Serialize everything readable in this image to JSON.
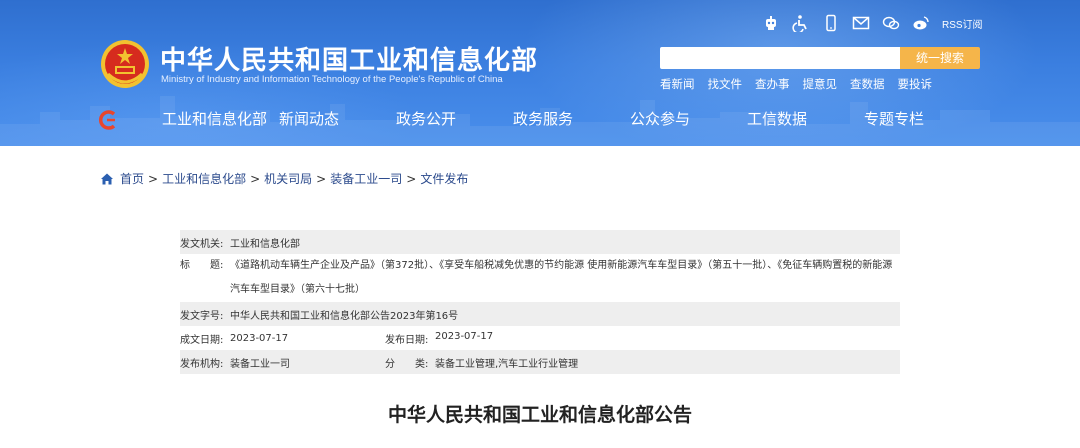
{
  "header": {
    "title": "中华人民共和国工业和信息化部",
    "subtitle": "Ministry of Industry and Information Technology of the People's Republic of China",
    "rss_label": "RSS订阅",
    "top_icons": [
      "robot-icon",
      "accessibility-icon",
      "mobile-icon",
      "mail-icon",
      "wechat-icon",
      "weibo-icon"
    ]
  },
  "search": {
    "placeholder": "",
    "button_label": "统一搜索"
  },
  "quick_links": [
    "看新闻",
    "找文件",
    "查办事",
    "提意见",
    "查数据",
    "要投诉"
  ],
  "nav": [
    "工业和信息化部",
    "新闻动态",
    "政务公开",
    "政务服务",
    "公众参与",
    "工信数据",
    "专题专栏"
  ],
  "breadcrumb": [
    "首页",
    "工业和信息化部",
    "机关司局",
    "装备工业一司",
    "文件发布"
  ],
  "info": {
    "issuer_label": "发文机关:",
    "issuer": "工业和信息化部",
    "title_label": "标　　题:",
    "title": "《道路机动车辆生产企业及产品》（第372批）、《享受车船税减免优惠的节约能源 使用新能源汽车车型目录》（第五十一批）、《免征车辆购置税的新能源汽车车型目录》（第六十七批）",
    "doc_no_label": "发文字号:",
    "doc_no": "中华人民共和国工业和信息化部公告2023年第16号",
    "written_date_label": "成文日期:",
    "written_date": "2023-07-17",
    "publish_date_label": "发布日期:",
    "publish_date": "2023-07-17",
    "org_label": "发布机构:",
    "org": "装备工业一司",
    "category_label": "分　　类:",
    "category": "装备工业管理,汽车工业行业管理"
  },
  "document": {
    "title": "中华人民共和国工业和信息化部公告"
  },
  "colors": {
    "header_blue": "#3b7fe0",
    "search_button": "#f5b54a",
    "info_row_shade": "#eeeeee",
    "link_blue": "#2b4a8c",
    "emblem_red": "#d62b1e",
    "emblem_gold": "#f2c230"
  }
}
